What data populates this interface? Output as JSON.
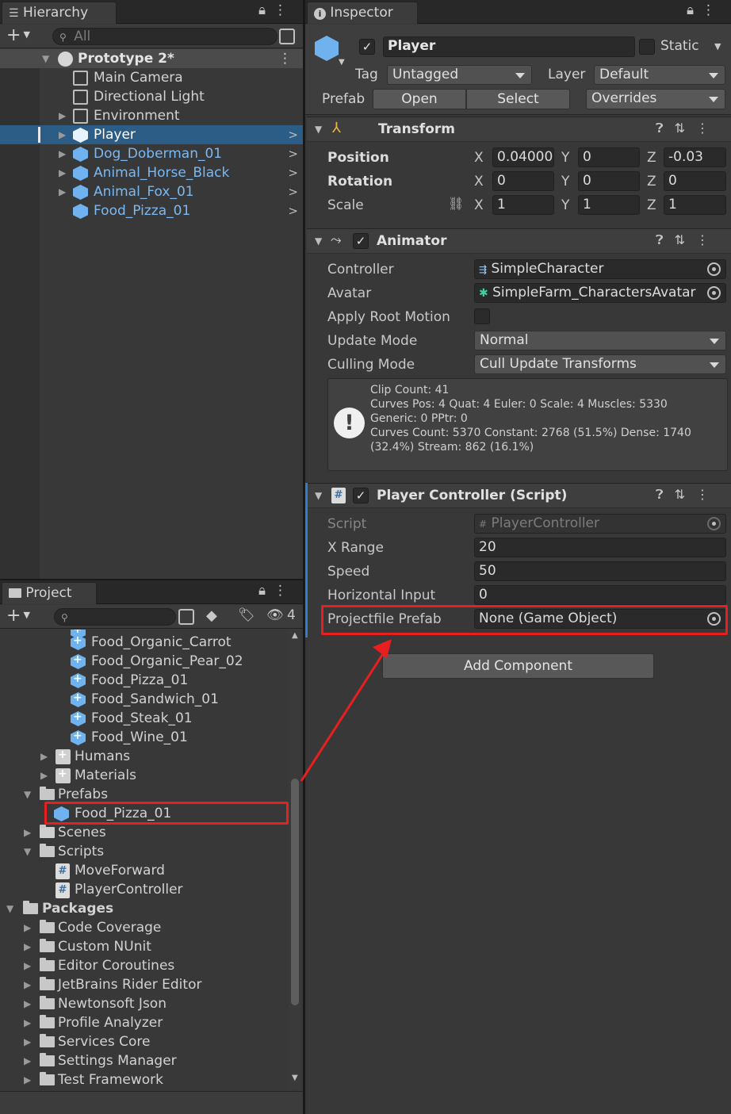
{
  "hierarchy": {
    "tab_label": "Hierarchy",
    "search_placeholder": "All",
    "scene_name": "Prototype 2*",
    "items": [
      {
        "label": "Main Camera",
        "prefab": false
      },
      {
        "label": "Directional Light",
        "prefab": false
      },
      {
        "label": "Environment",
        "prefab": false
      },
      {
        "label": "Player",
        "prefab": true
      },
      {
        "label": "Dog_Doberman_01",
        "prefab": true
      },
      {
        "label": "Animal_Horse_Black",
        "prefab": true
      },
      {
        "label": "Animal_Fox_01",
        "prefab": true
      },
      {
        "label": "Food_Pizza_01",
        "prefab": true
      }
    ]
  },
  "project": {
    "tab_label": "Project",
    "hidden_count": "4",
    "assets": [
      "Food_Organic_Carrot",
      "Food_Organic_Pear_02",
      "Food_Pizza_01",
      "Food_Sandwich_01",
      "Food_Steak_01",
      "Food_Wine_01"
    ],
    "folders": {
      "humans": "Humans",
      "materials": "Materials",
      "prefabs": "Prefabs",
      "prefab_item": "Food_Pizza_01",
      "scenes": "Scenes",
      "scripts": "Scripts",
      "script_items": [
        "MoveForward",
        "PlayerController"
      ]
    },
    "packages_label": "Packages",
    "packages": [
      "Code Coverage",
      "Custom NUnit",
      "Editor Coroutines",
      "JetBrains Rider Editor",
      "Newtonsoft Json",
      "Profile Analyzer",
      "Services Core",
      "Settings Manager",
      "Test Framework"
    ]
  },
  "inspector": {
    "tab_label": "Inspector",
    "object_name": "Player",
    "static_label": "Static",
    "tag_label": "Tag",
    "tag_value": "Untagged",
    "layer_label": "Layer",
    "layer_value": "Default",
    "prefab_label": "Prefab",
    "open_label": "Open",
    "select_label": "Select",
    "overrides_label": "Overrides",
    "transform": {
      "title": "Transform",
      "position_label": "Position",
      "rotation_label": "Rotation",
      "scale_label": "Scale",
      "axis_x": "X",
      "axis_y": "Y",
      "axis_z": "Z",
      "position": [
        "0.04000",
        "0",
        "-0.03"
      ],
      "rotation": [
        "0",
        "0",
        "0"
      ],
      "scale": [
        "1",
        "1",
        "1"
      ]
    },
    "animator": {
      "title": "Animator",
      "controller_label": "Controller",
      "controller_value": "SimpleCharacter",
      "avatar_label": "Avatar",
      "avatar_value": "SimpleFarm_CharactersAvatar",
      "root_motion_label": "Apply Root Motion",
      "update_mode_label": "Update Mode",
      "update_mode_value": "Normal",
      "culling_mode_label": "Culling Mode",
      "culling_mode_value": "Cull Update Transforms",
      "info_lines": [
        "Clip Count: 41",
        "Curves Pos: 4 Quat: 4 Euler: 0 Scale: 4 Muscles: 5330",
        "Generic: 0 PPtr: 0",
        "Curves Count: 5370 Constant: 2768 (51.5%) Dense: 1740",
        "(32.4%) Stream: 862 (16.1%)"
      ]
    },
    "player_controller": {
      "title": "Player Controller (Script)",
      "script_label": "Script",
      "script_value": "PlayerController",
      "x_range_label": "X Range",
      "x_range_value": "20",
      "speed_label": "Speed",
      "speed_value": "50",
      "horizontal_label": "Horizontal Input",
      "horizontal_value": "0",
      "projectile_label": "Projectfile Prefab",
      "projectile_value": "None (Game Object)"
    },
    "add_component_label": "Add Component"
  },
  "colors": {
    "selection": "#2c5d87",
    "prefab_blue": "#7ab9f3",
    "annotation_red": "#e81f1f"
  }
}
